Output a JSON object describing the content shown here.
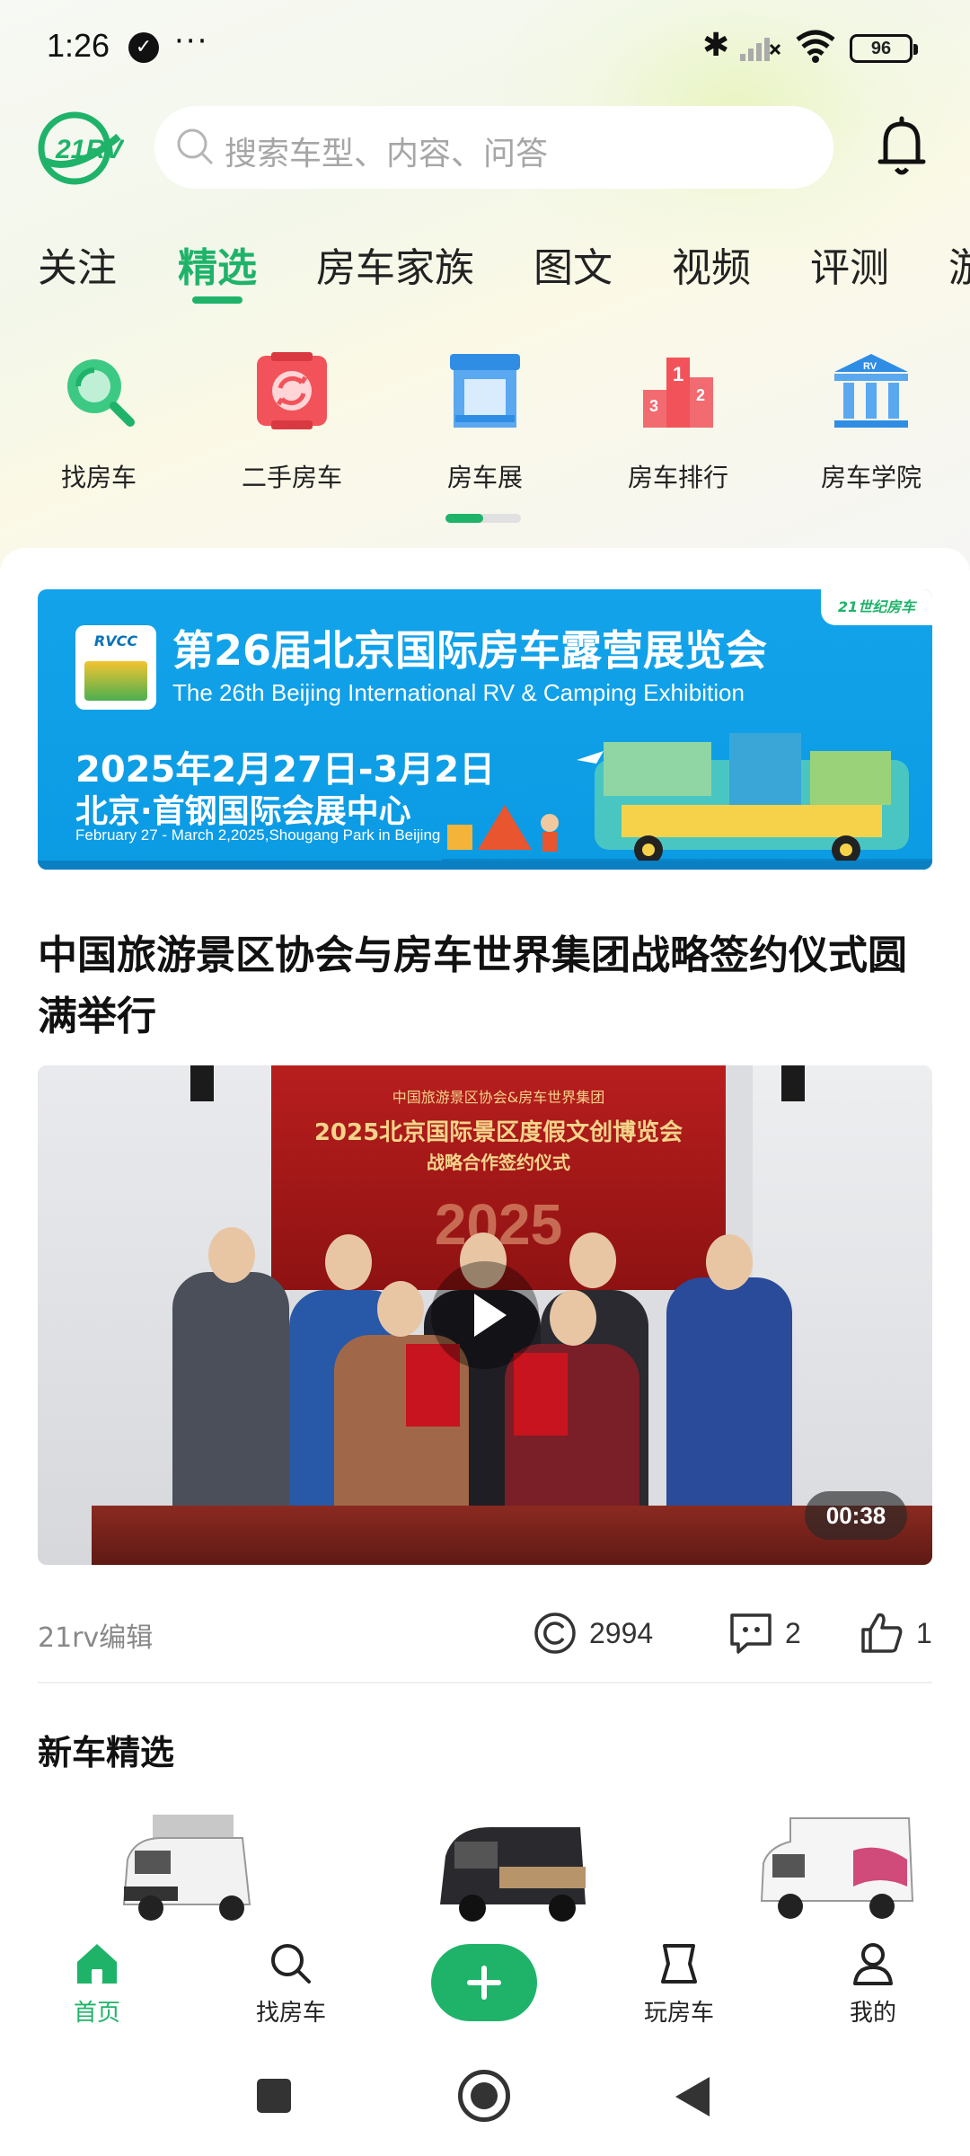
{
  "status_bar": {
    "time": "1:26",
    "more_dots": "···",
    "battery": "96",
    "bluetooth": "✱"
  },
  "header": {
    "logo_text": "21RV",
    "search_placeholder": "搜索车型、内容、问答"
  },
  "tabs": [
    {
      "label": "关注",
      "active": false
    },
    {
      "label": "精选",
      "active": true
    },
    {
      "label": "房车家族",
      "active": false
    },
    {
      "label": "图文",
      "active": false
    },
    {
      "label": "视频",
      "active": false
    },
    {
      "label": "评测",
      "active": false
    },
    {
      "label": "游",
      "active": false
    }
  ],
  "quick_entries": [
    {
      "label": "找房车",
      "icon": "magnifier-icon"
    },
    {
      "label": "二手房车",
      "icon": "recycle-icon"
    },
    {
      "label": "房车展",
      "icon": "exhibition-icon"
    },
    {
      "label": "房车排行",
      "icon": "podium-icon"
    },
    {
      "label": "房车学院",
      "icon": "academy-icon"
    }
  ],
  "banner": {
    "logo_text": "RVCC",
    "title": "第26届北京国际房车露营展览会",
    "subtitle": "The 26th Beijing International RV & Camping Exhibition",
    "date": "2025年2月27日-3月2日",
    "venue": "北京·首钢国际会展中心",
    "venue_en": "February 27 - March 2,2025,Shougang Park in Beijing",
    "brand": "21世纪房车"
  },
  "article": {
    "title": "中国旅游景区协会与房车世界集团战略签约仪式圆满举行",
    "video": {
      "backdrop_line1": "中国旅游景区协会&房车世界集团",
      "backdrop_line2": "2025北京国际景区度假文创博览会",
      "backdrop_line3": "战略合作签约仪式",
      "backdrop_year": "2025",
      "duration": "00:38"
    },
    "author": "21rv编辑",
    "views": "2994",
    "comments": "2",
    "likes": "1"
  },
  "section": {
    "title": "新车精选"
  },
  "bottom_nav": [
    {
      "label": "首页",
      "icon": "home-icon",
      "active": true
    },
    {
      "label": "找房车",
      "icon": "search-icon",
      "active": false
    },
    {
      "label": "玩房车",
      "icon": "play-rv-icon",
      "active": false
    },
    {
      "label": "我的",
      "icon": "user-icon",
      "active": false
    }
  ],
  "colors": {
    "accent": "#1fb36a",
    "banner_blue": "#13a3ea"
  }
}
